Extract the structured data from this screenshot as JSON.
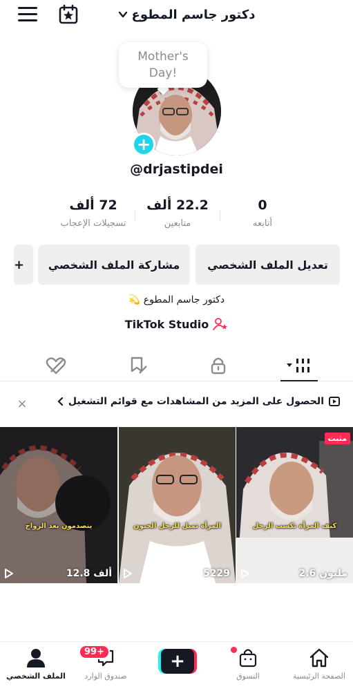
{
  "header": {
    "title": "دكتور جاسم المطوع",
    "menu_icon": "hamburger-icon",
    "calendar_icon": "star-calendar-icon"
  },
  "profile": {
    "note": "Mother's Day!",
    "username": "@drjastipdei",
    "add_icon": "+",
    "bio": "دكتور جاسم المطوع 💫",
    "studio": "TikTok Studio"
  },
  "stats": {
    "following": {
      "value": "0",
      "label": "أتابعه"
    },
    "followers": {
      "value": "22.2 ألف",
      "label": "متابعين"
    },
    "likes": {
      "value": "72 ألف",
      "label": "تسجيلات الإعجاب"
    }
  },
  "buttons": {
    "edit": "تعديل الملف الشخصي",
    "share": "مشاركة الملف الشخصي",
    "add_friend": "+"
  },
  "tabs": [
    "videos-grid-icon",
    "lock-icon",
    "favorites-icon",
    "liked-icon"
  ],
  "banner": {
    "text": "الحصول على المزيد من المشاهدات مع قوائم التشغيل",
    "close": "×"
  },
  "videos": [
    {
      "views": "2.6 مليون",
      "caption": "كيف المرأة تكسب الرجل",
      "pinned": "مثبت"
    },
    {
      "views": "5229",
      "caption": "المرأة تميل للرجل الحنون"
    },
    {
      "views": "12.8 ألف",
      "caption": "ينصدمون بعد الزواج"
    }
  ],
  "nav": {
    "home": "الصفحة الرئيسية",
    "shop": "التسوق",
    "inbox": "صندوق الوارد",
    "inbox_badge": "99+",
    "profile": "الملف الشخصي"
  },
  "colors": {
    "accent": "#fe2c55",
    "cyan": "#25f4ee",
    "text": "#161823",
    "muted": "#8a8b91"
  }
}
